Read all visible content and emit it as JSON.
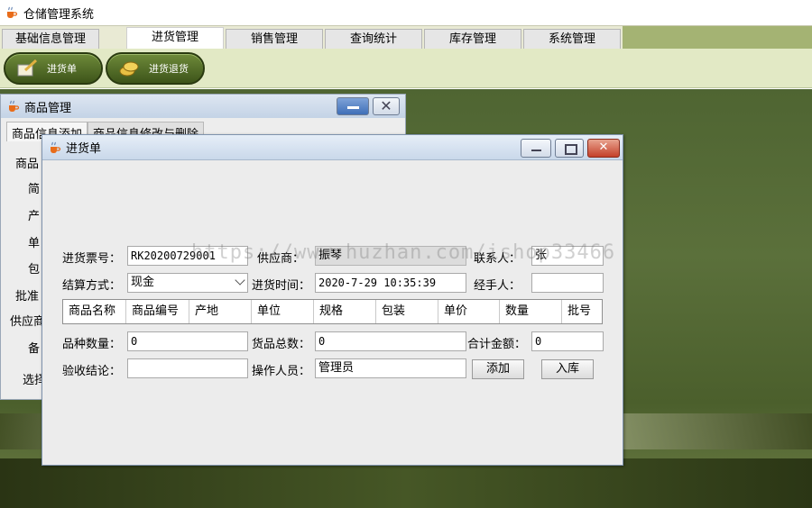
{
  "app": {
    "title": "仓储管理系统"
  },
  "menu": {
    "tabs": [
      {
        "label": "基础信息管理"
      },
      {
        "label": "进货管理"
      },
      {
        "label": "销售管理"
      },
      {
        "label": "查询统计"
      },
      {
        "label": "库存管理"
      },
      {
        "label": "系统管理"
      }
    ],
    "active_tab": "进货管理"
  },
  "toolbar": {
    "purchase_label": "进货单",
    "return_label": "进货退货"
  },
  "product_frame": {
    "title": "商品管理",
    "tabs": [
      {
        "label": "商品信息添加"
      },
      {
        "label": "商品信息修改与删除"
      }
    ],
    "labels": {
      "name": "商品",
      "short": "简",
      "origin": "产",
      "unit": "单",
      "pack": "包",
      "approve": "批准",
      "supplier": "供应商",
      "note": "备",
      "select": "选择"
    }
  },
  "purchase_frame": {
    "title": "进货单",
    "ticket_no_label": "进货票号：",
    "ticket_no_value": "RK20200729001",
    "supplier_label": "供应商：",
    "supplier_value": "振琴",
    "contact_label": "联系人：",
    "contact_value": "张",
    "settle_label": "结算方式：",
    "settle_value": "现金",
    "time_label": "进货时间：",
    "time_value": "2020-7-29 10:35:39",
    "handler_label": "经手人：",
    "handler_value": "",
    "table_columns": [
      "商品名称",
      "商品编号",
      "产地",
      "单位",
      "规格",
      "包装",
      "单价",
      "数量",
      "批号"
    ],
    "kinds_label": "品种数量：",
    "kinds_value": "0",
    "total_qty_label": "货品总数：",
    "total_qty_value": "0",
    "total_amount_label": "合计金额：",
    "total_amount_value": "0",
    "check_label": "验收结论：",
    "check_value": "",
    "operator_label": "操作人员：",
    "operator_value": "管理员",
    "add_button": "添加",
    "stock_in_button": "入库"
  },
  "watermark": "https://www.huzhan.com/ishop33466"
}
